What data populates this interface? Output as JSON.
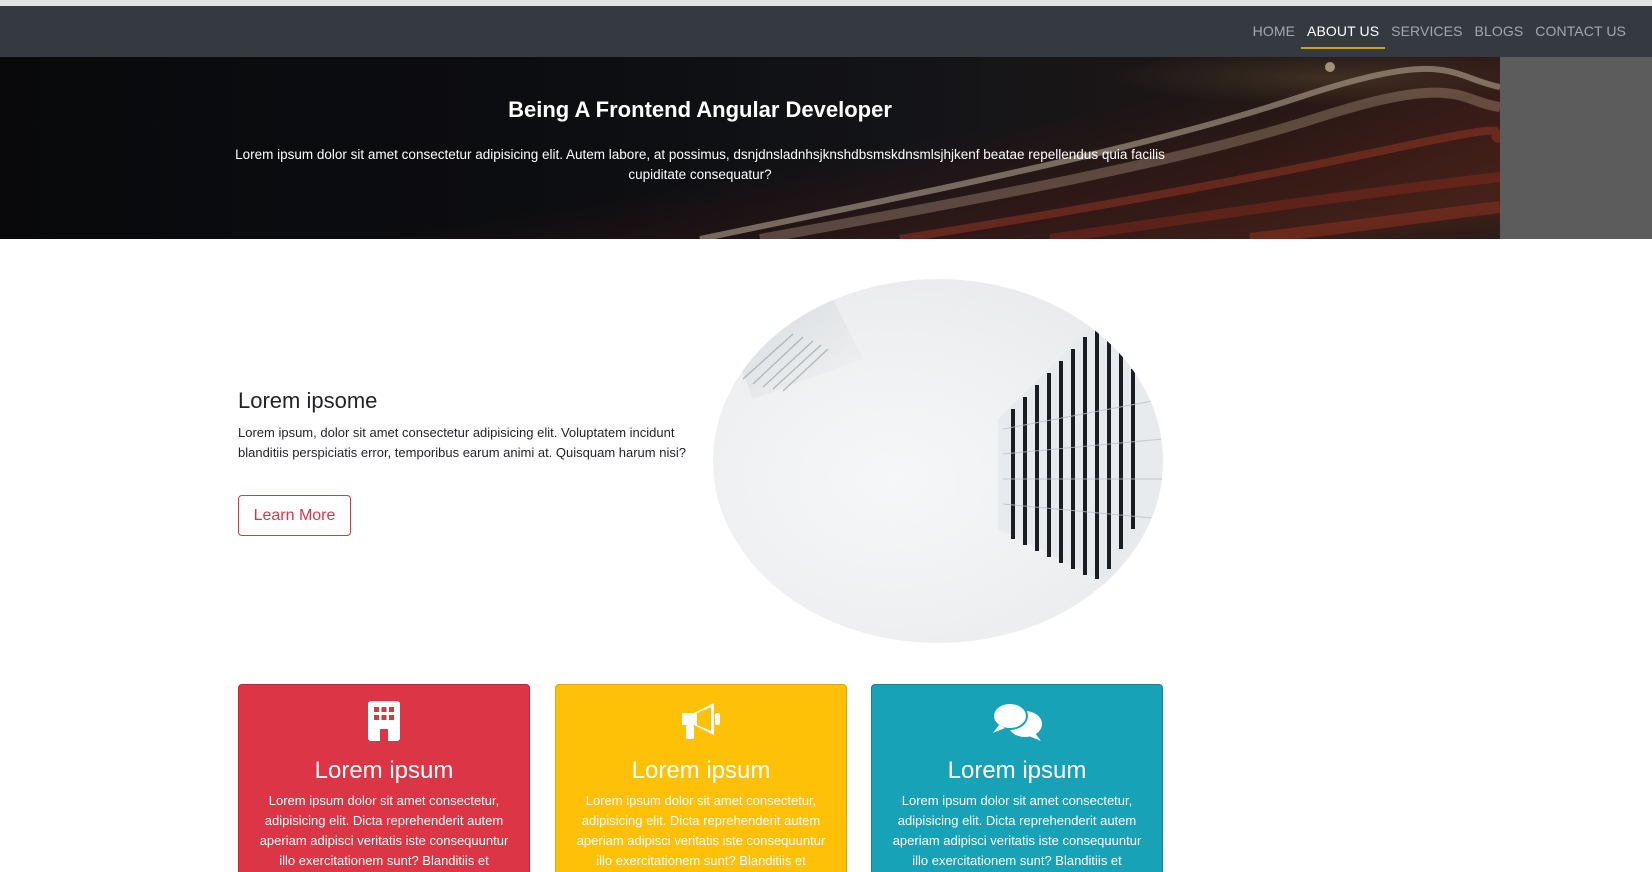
{
  "navbar": {
    "items": [
      {
        "label": "HOME"
      },
      {
        "label": "ABOUT US"
      },
      {
        "label": "SERVICES"
      },
      {
        "label": "BLOGS"
      },
      {
        "label": "CONTACT US"
      }
    ],
    "active_index": 1,
    "active_underline_color": "#c9a227",
    "background": "#343a40"
  },
  "hero": {
    "title": "Being A Frontend Angular Developer",
    "text": "Lorem ipsum dolor sit amet consectetur adipisicing elit. Autem labore, at possimus, dsnjdnsladnhsjknshdbsmskdnsmlsjhjkenf beatae repellendus quia facilis cupiditate consequatur?"
  },
  "about": {
    "heading": "Lorem ipsome",
    "text": "Lorem ipsum, dolor sit amet consectetur adipisicing elit. Voluptatem incidunt blanditiis perspiciatis error, temporibus earum animi at. Quisquam harum nisi?",
    "button_label": "Learn More",
    "button_color": "#dc3545"
  },
  "cards": [
    {
      "icon": "building-icon",
      "title": "Lorem ipsum",
      "text": "Lorem ipsum dolor sit amet consectetur, adipisicing elit. Dicta reprehenderit autem aperiam adipisci veritatis iste consequuntur illo exercitationem sunt? Blanditiis et",
      "color": "#dc3545"
    },
    {
      "icon": "megaphone-icon",
      "title": "Lorem ipsum",
      "text": "Lorem ipsum dolor sit amet consectetur, adipisicing elit. Dicta reprehenderit autem aperiam adipisci veritatis iste consequuntur illo exercitationem sunt? Blanditiis et",
      "color": "#ffc107"
    },
    {
      "icon": "comments-icon",
      "title": "Lorem ipsum",
      "text": "Lorem ipsum dolor sit amet consectetur, adipisicing elit. Dicta reprehenderit autem aperiam adipisci veritatis iste consequuntur illo exercitationem sunt? Blanditiis et",
      "color": "#17a2b8"
    }
  ]
}
